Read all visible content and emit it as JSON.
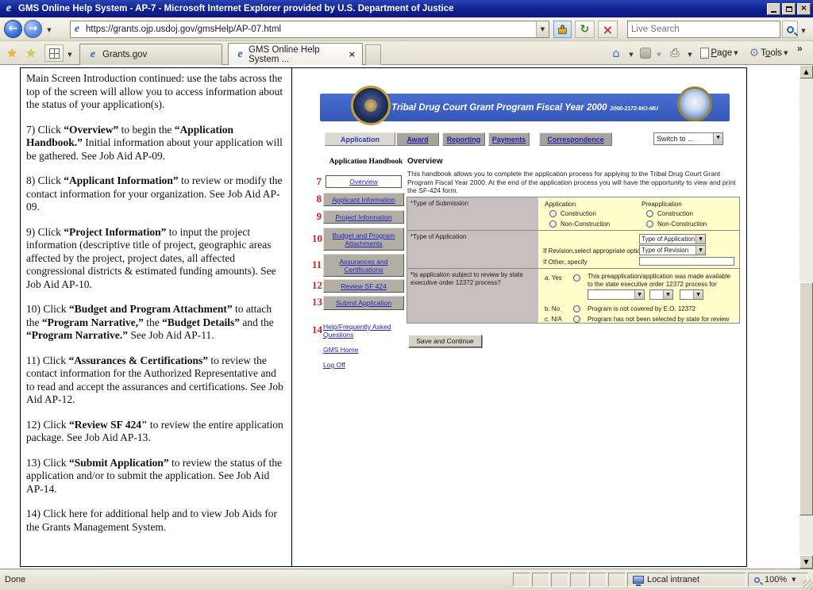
{
  "window": {
    "title": "GMS Online Help System - AP-7 - Microsoft Internet Explorer provided by U.S. Department of Justice"
  },
  "icons": {
    "ie_logo": "e",
    "back": "←",
    "forward": "→",
    "dropdown": "▼",
    "refresh": "↻",
    "stop": "×",
    "star": "★",
    "star_plus": "★",
    "house": "⌂",
    "printer": "⎙",
    "gear": "⚙",
    "chevron_more": "»",
    "close": "×",
    "scroll_up": "▲",
    "scroll_down": "▼"
  },
  "nav": {
    "url": "https://grants.ojp.usdoj.gov/gmsHelp/AP-07.html",
    "search_placeholder": "Live Search"
  },
  "tabs": {
    "tab1": "Grants.gov",
    "tab2": "GMS Online Help System ..."
  },
  "toolbar": {
    "page_label": [
      {
        "t": "P",
        "u": true
      },
      {
        "t": "age"
      }
    ],
    "tools_label": [
      {
        "t": "T",
        "u": false
      },
      {
        "t": "o",
        "u": true
      },
      {
        "t": "ols"
      }
    ]
  },
  "status": {
    "done": "Done",
    "zone": "Local intranet",
    "zoom": "100%"
  },
  "left_panel": {
    "paragraphs": [
      [
        {
          "t": "Main Screen Introduction continued: use the tabs across the top of the screen will allow you to access information about the status of your application(s)."
        }
      ],
      [
        {
          "t": "7) Click "
        },
        {
          "t": "“Overview”",
          "b": true
        },
        {
          "t": " to begin the "
        },
        {
          "t": "“Application Handbook.”",
          "b": true
        },
        {
          "t": "  Initial information about your application will be gathered. See Job Aid AP-09."
        }
      ],
      [
        {
          "t": "8) Click "
        },
        {
          "t": "“Applicant Information”",
          "b": true
        },
        {
          "t": " to review or modify the contact information for your organization. See Job Aid AP-09."
        }
      ],
      [
        {
          "t": "9) Click "
        },
        {
          "t": "“Project Information”",
          "b": true
        },
        {
          "t": " to input the project information (descriptive title of project, geographic areas affected by the project, project dates, all affected congressional districts & estimated funding amounts).  See Job Aid AP-10."
        }
      ],
      [
        {
          "t": "10) Click "
        },
        {
          "t": "“Budget and Program Attachment”",
          "b": true
        },
        {
          "t": " to attach the "
        },
        {
          "t": "“Program Narrative,”",
          "b": true
        },
        {
          "t": " the "
        },
        {
          "t": "“Budget Details”",
          "b": true
        },
        {
          "t": " and the "
        },
        {
          "t": "“Program Narrative.”",
          "b": true
        },
        {
          "t": "  See Job Aid AP-11."
        }
      ],
      [
        {
          "t": "11) Click "
        },
        {
          "t": "“Assurances & Certifications”",
          "b": true
        },
        {
          "t": " to review the contact information for the Authorized Representative and to read and accept the assurances and certifications.  See Job Aid AP-12."
        }
      ],
      [
        {
          "t": "12) Click "
        },
        {
          "t": "“Review SF 424\"",
          "b": true
        },
        {
          "t": " to review the entire application package. See Job Aid AP-13."
        }
      ],
      [
        {
          "t": "13) Click "
        },
        {
          "t": "“Submit Application”",
          "b": true
        },
        {
          "t": " to review the status of the application and/or to submit the application.  See Job Aid AP-14."
        }
      ],
      [
        {
          "t": "14) Click here for additional help and to view Job Aids for the Grants Management System."
        }
      ]
    ]
  },
  "gms": {
    "header": {
      "title": "Tribal Drug Court Grant Program Fiscal Year 2000",
      "code": "2000-2172-MO-MU"
    },
    "tabs": [
      "Application",
      "Award",
      "Reporting",
      "Payments",
      "Correspondence"
    ],
    "switch_to": "Switch to ...",
    "sidebar": {
      "heading": "Application Handbook",
      "buttons": [
        {
          "num": "7",
          "label": "Overview"
        },
        {
          "num": "8",
          "label": "Applicant Information"
        },
        {
          "num": "9",
          "label": "Project Information"
        },
        {
          "num": "10",
          "label": "Budget and Program Attachments"
        },
        {
          "num": "11",
          "label": "Assurances and Certifications"
        },
        {
          "num": "12",
          "label": "Review SF 424"
        },
        {
          "num": "13",
          "label": "Submit Application"
        }
      ],
      "links": [
        {
          "num": "14",
          "label": "Help/Frequently Asked Questions"
        },
        {
          "num": "",
          "label": "GMS Home"
        },
        {
          "num": "",
          "label": "Log Off"
        }
      ]
    },
    "main": {
      "heading": "Overview",
      "intro": "This handbook allows you to complete the application process for applying to the Tribal Drug Court Grant Program Fiscal Year 2000. At the end of the application process you will have the opportunity to view and print the SF-424 form.",
      "form": {
        "row1_label": "*Type of Submission",
        "col_application": "Application",
        "col_preapplication": "Preapplication",
        "radio_construction": "Construction",
        "radio_non_construction": "Non-Construction",
        "row2_label": "*Type of Application",
        "dd_type_of_application": "Type of Application",
        "revision_label": "If Revision,select appropriate option",
        "dd_type_of_revision": "Type of Revision",
        "other_label": "If Other, specify",
        "row3_label": "*Is application subject to review by state executive order 12372 process?",
        "a_yes": "a. Yes",
        "a_text": "This preapplication/application was made available to the state executive order 12372 process for review on",
        "b_no": "b. No",
        "b_text": "Program is not covered by  E.O. 12372",
        "c_na": "c. N/A",
        "c_text": "Program has not been selected by state for review"
      },
      "save_button": "Save and Continue"
    }
  }
}
